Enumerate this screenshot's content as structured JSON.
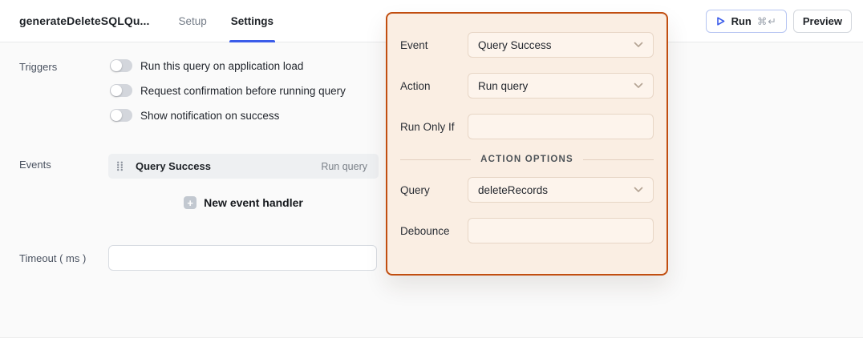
{
  "header": {
    "title": "generateDeleteSQLQu...",
    "tabs": [
      {
        "label": "Setup",
        "active": false
      },
      {
        "label": "Settings",
        "active": true
      }
    ],
    "run_button": {
      "label": "Run",
      "shortcut": "⌘↵"
    },
    "preview_button": {
      "label": "Preview"
    }
  },
  "triggers": {
    "section_label": "Triggers",
    "items": [
      {
        "label": "Run this query on application load",
        "enabled": false
      },
      {
        "label": "Request confirmation before running query",
        "enabled": false
      },
      {
        "label": "Show notification on success",
        "enabled": false
      }
    ]
  },
  "events": {
    "section_label": "Events",
    "handlers": [
      {
        "event": "Query Success",
        "action": "Run query"
      }
    ],
    "new_handler_label": "New event handler"
  },
  "timeout": {
    "label": "Timeout ( ms )",
    "value": "",
    "placeholder": ""
  },
  "popover": {
    "fields": [
      {
        "label": "Event",
        "value": "Query Success",
        "type": "select"
      },
      {
        "label": "Action",
        "value": "Run query",
        "type": "select"
      },
      {
        "label": "Run Only If",
        "value": "",
        "type": "input"
      }
    ],
    "divider_label": "ACTION OPTIONS",
    "action_fields": [
      {
        "label": "Query",
        "value": "deleteRecords",
        "type": "select"
      },
      {
        "label": "Debounce",
        "value": "",
        "type": "input"
      }
    ]
  },
  "colors": {
    "accent-orange": "#c14e10",
    "panel-bg": "#faeee3",
    "field-bg": "#fdf4ec",
    "field-border": "#e7d6c6",
    "tab-blue": "#3b5ce9",
    "run-border": "#b6c5f2",
    "content-bg": "#fafafa"
  }
}
